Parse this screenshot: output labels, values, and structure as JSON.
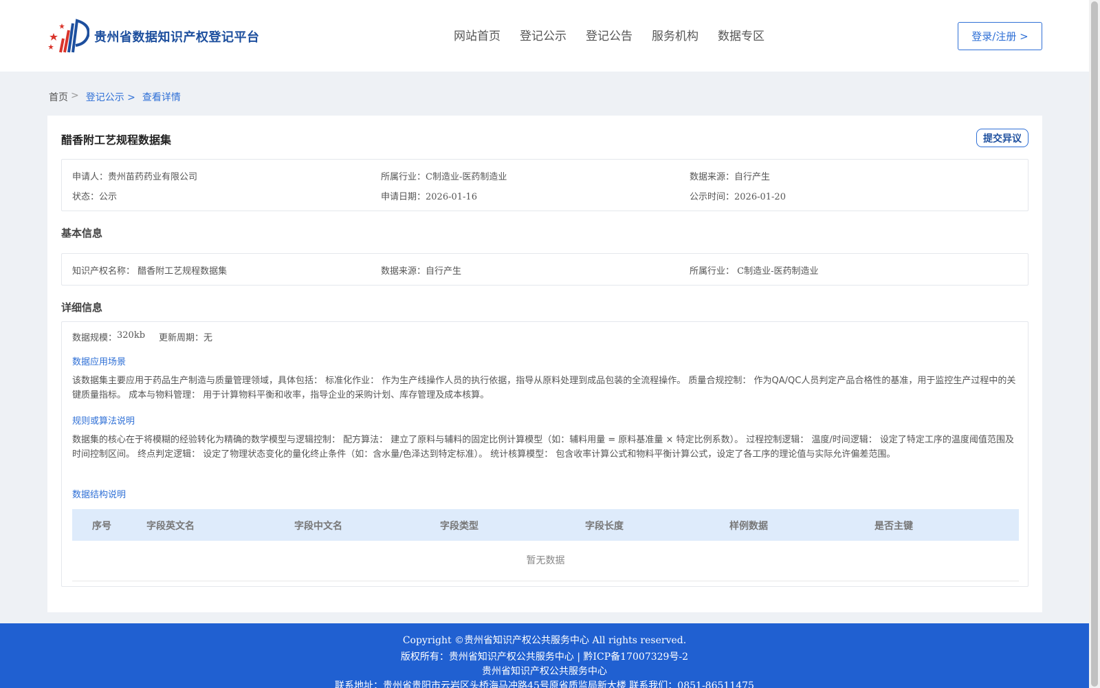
{
  "header": {
    "site_title": "贵州省数据知识产权登记平台",
    "nav": [
      "网站首页",
      "登记公示",
      "登记公告",
      "服务机构",
      "数据专区"
    ],
    "login_label": "登录/注册 >"
  },
  "breadcrumb": {
    "home": "首页",
    "sep": ">",
    "items": [
      "登记公示 >",
      "查看详情"
    ]
  },
  "detail": {
    "title": "醋香附工艺规程数据集",
    "objection_label": "提交异议",
    "summary": [
      [
        {
          "label": "申请人：",
          "value": "贵州苗药药业有限公司"
        },
        {
          "label": "所属行业：",
          "value": "C制造业-医药制造业"
        },
        {
          "label": "数据来源：",
          "value": "自行产生"
        }
      ],
      [
        {
          "label": "状态：",
          "value": "公示"
        },
        {
          "label": "申请日期：",
          "value": "2026-01-16"
        },
        {
          "label": "公示时间：",
          "value": "2026-01-20"
        }
      ]
    ],
    "basic_title": "基本信息",
    "basic": [
      {
        "label": "知识产权名称：",
        "value": "醋香附工艺规程数据集"
      },
      {
        "label": "数据来源：",
        "value": "自行产生"
      },
      {
        "label": "所属行业：",
        "value": "C制造业-医药制造业"
      }
    ],
    "detail_title": "详细信息",
    "scale_label": "数据规模：",
    "scale_value": "320kb",
    "cycle_label": "更新周期：",
    "cycle_value": "无",
    "scene_title": "数据应用场景",
    "scene_text": "该数据集主要应用于药品生产制造与质量管理领域，具体包括： 标准化作业： 作为生产线操作人员的执行依据，指导从原料处理到成品包装的全流程操作。 质量合规控制： 作为QA/QC人员判定产品合格性的基准，用于监控生产过程中的关键质量指标。 成本与物料管理： 用于计算物料平衡和收率，指导企业的采购计划、库存管理及成本核算。",
    "rule_title": "规则或算法说明",
    "rule_text": "数据集的核心在于将模糊的经验转化为精确的数学模型与逻辑控制： 配方算法： 建立了原料与辅料的固定比例计算模型（如：辅料用量 = 原料基准量 × 特定比例系数）。 过程控制逻辑： 温度/时间逻辑： 设定了特定工序的温度阈值范围及时间控制区间。 终点判定逻辑： 设定了物理状态变化的量化终止条件（如：含水量/色泽达到特定标准）。 统计核算模型： 包含收率计算公式和物料平衡计算公式，设定了各工序的理论值与实际允许偏差范围。",
    "struct_title": "数据结构说明",
    "table_headers": [
      "序号",
      "字段英文名",
      "字段中文名",
      "字段类型",
      "字段长度",
      "样例数据",
      "是否主键"
    ],
    "empty_text": "暂无数据"
  },
  "footer": {
    "copyright": "Copyright ©贵州省知识产权公共服务中心 All rights reserved.",
    "owner": "版权所有：贵州省知识产权公共服务中心 | 黔ICP备17007329号-2",
    "org": "贵州省知识产权公共服务中心",
    "contact": "联系地址：贵州省贵阳市云岩区头桥海马冲路45号原省质监局新大楼 联系我们：0851-86511475"
  }
}
